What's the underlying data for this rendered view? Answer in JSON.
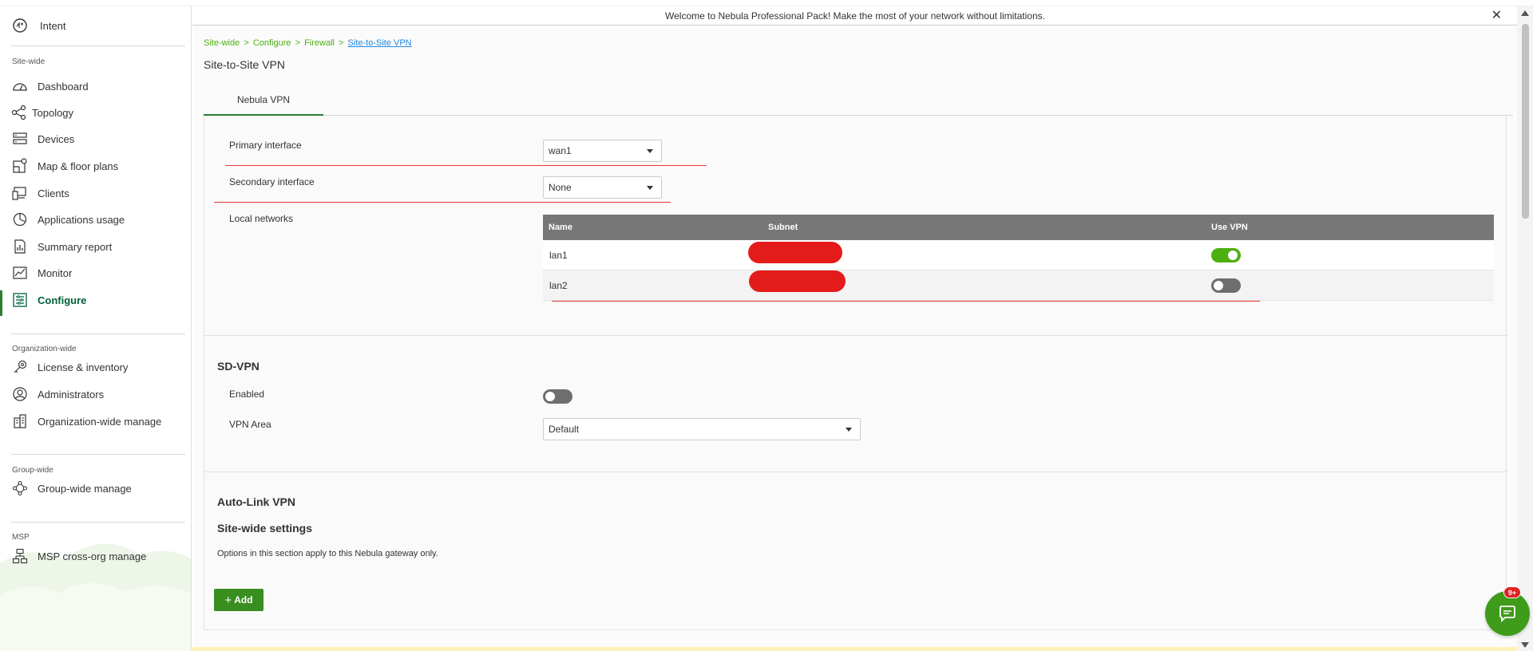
{
  "banner": {
    "text": "Welcome to Nebula Professional Pack! Make the most of your network without limitations.",
    "close": "✕"
  },
  "sidebar": {
    "intent_label": "Intent",
    "sections": {
      "site_wide": "Site-wide",
      "organization_wide": "Organization-wide",
      "group_wide": "Group-wide",
      "msp": "MSP"
    },
    "items": [
      {
        "label": "Dashboard",
        "icon": "dashboard-icon"
      },
      {
        "label": "Topology",
        "icon": "topology-icon"
      },
      {
        "label": "Devices",
        "icon": "devices-icon"
      },
      {
        "label": "Map & floor plans",
        "icon": "map-icon"
      },
      {
        "label": "Clients",
        "icon": "clients-icon"
      },
      {
        "label": "Applications usage",
        "icon": "pie-chart-icon"
      },
      {
        "label": "Summary report",
        "icon": "report-icon"
      },
      {
        "label": "Monitor",
        "icon": "monitor-icon"
      },
      {
        "label": "Configure",
        "icon": "configure-icon",
        "active": true
      },
      {
        "label": "License & inventory",
        "icon": "license-icon"
      },
      {
        "label": "Administrators",
        "icon": "administrators-icon"
      },
      {
        "label": "Organization-wide manage",
        "icon": "building-icon"
      },
      {
        "label": "Group-wide manage",
        "icon": "group-icon"
      },
      {
        "label": "MSP cross-org manage",
        "icon": "msp-icon"
      }
    ]
  },
  "breadcrumb": {
    "items": [
      "Site-wide",
      "Configure",
      "Firewall"
    ],
    "separator": ">",
    "current": "Site-to-Site VPN"
  },
  "page_title": "Site-to-Site VPN",
  "tabs": [
    {
      "label": "Nebula VPN",
      "active": true
    }
  ],
  "nebula_vpn": {
    "primary_label": "Primary interface",
    "primary_value": "wan1",
    "secondary_label": "Secondary interface",
    "secondary_value": "None",
    "local_networks_label": "Local networks",
    "table": {
      "headers": {
        "name": "Name",
        "subnet": "Subnet",
        "use_vpn": "Use VPN"
      },
      "rows": [
        {
          "name": "lan1",
          "use_vpn": true
        },
        {
          "name": "lan2",
          "use_vpn": false
        }
      ]
    }
  },
  "sd_vpn": {
    "title": "SD-VPN",
    "enabled_label": "Enabled",
    "enabled": false,
    "area_label": "VPN Area",
    "area_value": "Default"
  },
  "auto_link": {
    "title": "Auto-Link VPN",
    "subtitle": "Site-wide settings",
    "description": "Options in this section apply to this Nebula gateway only.",
    "add_label": "Add"
  },
  "chat": {
    "badge": "9+"
  },
  "colors": {
    "accent": "#4caf10",
    "active": "#2e7d32",
    "redaction": "#e31b1b"
  }
}
